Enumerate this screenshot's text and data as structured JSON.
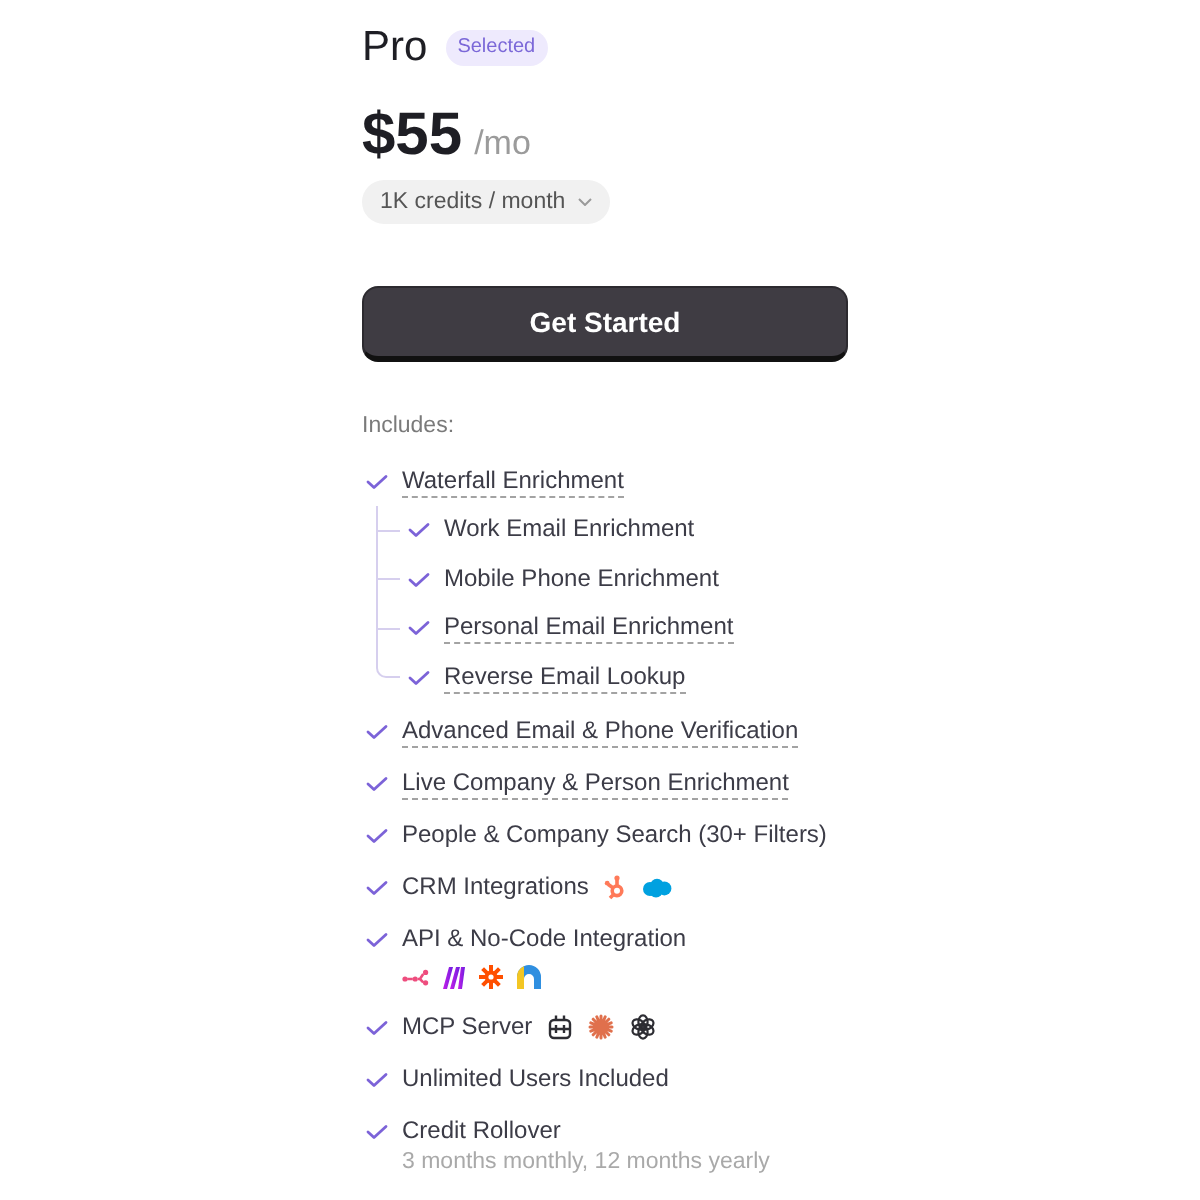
{
  "plan": {
    "name": "Pro",
    "badge": "Selected"
  },
  "price": {
    "amount": "$55",
    "period": "/mo"
  },
  "credits_select": {
    "value": "1K credits / month"
  },
  "cta_button": "Get Started",
  "includes_label": "Includes:",
  "features": [
    {
      "label": "Waterfall Enrichment",
      "underlined": true,
      "children": [
        {
          "label": "Work Email Enrichment",
          "underlined": false
        },
        {
          "label": "Mobile Phone Enrichment",
          "underlined": false
        },
        {
          "label": "Personal Email Enrichment",
          "underlined": true
        },
        {
          "label": "Reverse Email Lookup",
          "underlined": true
        }
      ]
    },
    {
      "label": "Advanced Email & Phone Verification",
      "underlined": true
    },
    {
      "label": "Live Company & Person Enrichment",
      "underlined": true
    },
    {
      "label": "People & Company Search (30+ Filters)",
      "underlined": false
    },
    {
      "label": "CRM Integrations",
      "underlined": false
    },
    {
      "label": "API & No-Code Integration",
      "underlined": false
    },
    {
      "label": "MCP Server",
      "underlined": false
    },
    {
      "label": "Unlimited Users Included",
      "underlined": false
    },
    {
      "label": "Credit Rollover",
      "underlined": false,
      "note": "3 months monthly, 12 months yearly"
    }
  ]
}
